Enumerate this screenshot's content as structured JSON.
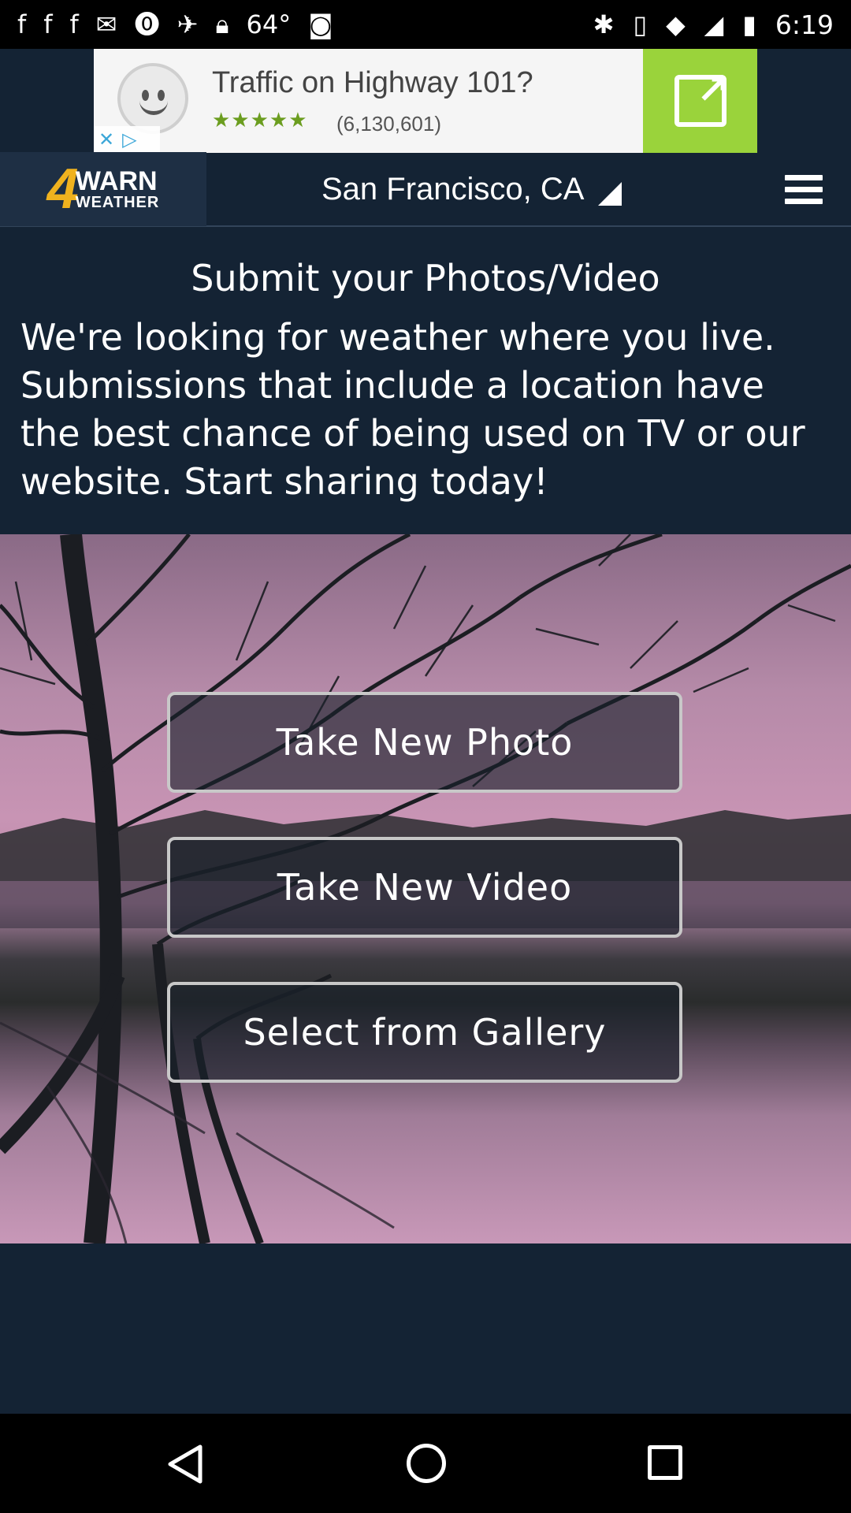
{
  "status_bar": {
    "temperature": "64°",
    "time": "6:19"
  },
  "ad": {
    "title": "Traffic on Highway 101?",
    "stars": "★★★★★",
    "rating_count": "(6,130,601)"
  },
  "header": {
    "logo_number": "4",
    "logo_warn": "WARN",
    "logo_weather": "WEATHER",
    "location": "San Francisco, CA"
  },
  "intro": {
    "title": "Submit your Photos/Video",
    "body": "We're looking for weather where you live. Submissions that include a location have the best chance of being used on TV or our website. Start sharing today!"
  },
  "actions": {
    "take_photo": "Take New Photo",
    "take_video": "Take New Video",
    "select_gallery": "Select from Gallery"
  },
  "colors": {
    "header_bg": "#142334",
    "ad_accent": "#9ad33b",
    "logo_accent": "#f0b21e"
  }
}
